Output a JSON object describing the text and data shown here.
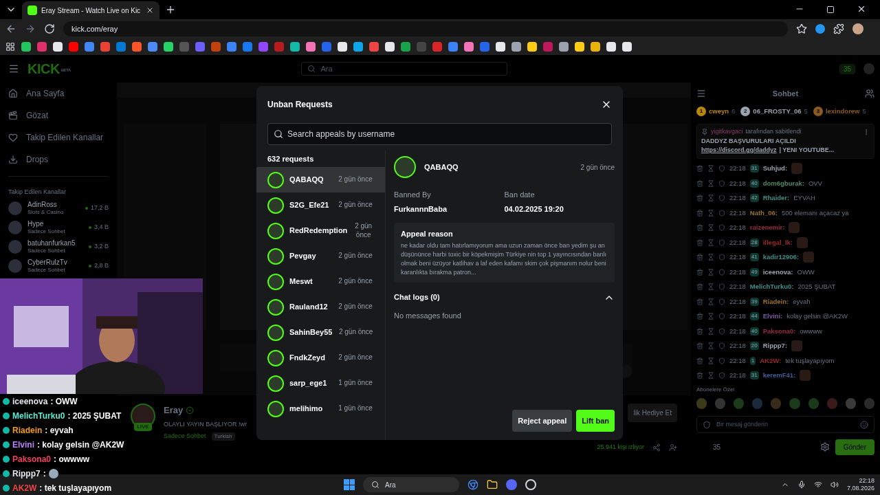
{
  "browser": {
    "tab_title": "Eray Stream - Watch Live on Kic",
    "url": "kick.com/eray"
  },
  "site": {
    "logo": "KICK",
    "logo_tag": "BETA",
    "search_placeholder": "Ara",
    "points": "35"
  },
  "sidebar": {
    "nav": [
      "Ana Sayfa",
      "Gözat",
      "Takip Edilen Kanallar",
      "Drops"
    ],
    "section": "Takip Edilen Kanallar",
    "channels": [
      {
        "name": "AdinRoss",
        "category": "Slots & Casino",
        "viewers": "17,2 B"
      },
      {
        "name": "Hype",
        "category": "Sadece Sohbet",
        "viewers": "3,4 B"
      },
      {
        "name": "batuhanfurkan5",
        "category": "Sadece Sohbet",
        "viewers": "3,2 B"
      },
      {
        "name": "CyberRulzTv",
        "category": "Sadece Sohbet",
        "viewers": "2,8 B"
      }
    ]
  },
  "stream": {
    "streamer": "Eray",
    "live_badge": "LIVE",
    "title": "OLAYLI YAYIN BAŞLIYOR !wr",
    "tags": [
      "Sadece Sohbet",
      "Turkish"
    ],
    "viewers": "25.941 kişi izliyor",
    "gift_button": "lik Hediye Et"
  },
  "modal": {
    "title": "Unban Requests",
    "search_placeholder": "Search appeals by username",
    "count": "632 requests",
    "requests": [
      {
        "name": "QABAQQ",
        "time": "2 gün önce",
        "selected": true
      },
      {
        "name": "S2G_Efe21",
        "time": "2 gün önce",
        "selected": false
      },
      {
        "name": "RedRedemption",
        "time": "2 gün önce",
        "selected": false
      },
      {
        "name": "Pevgay",
        "time": "2 gün önce",
        "selected": false
      },
      {
        "name": "Meswt",
        "time": "2 gün önce",
        "selected": false
      },
      {
        "name": "Rauland12",
        "time": "2 gün önce",
        "selected": false
      },
      {
        "name": "SahinBey55",
        "time": "2 gün önce",
        "selected": false
      },
      {
        "name": "FndkZeyd",
        "time": "2 gün önce",
        "selected": false
      },
      {
        "name": "sarp_ege1",
        "time": "1 gün önce",
        "selected": false
      },
      {
        "name": "melihimo",
        "time": "1 gün önce",
        "selected": false
      }
    ],
    "detail": {
      "name": "QABAQQ",
      "time": "2 gün önce",
      "banned_by_label": "Banned By",
      "banned_by": "FurkannnBaba",
      "ban_date_label": "Ban date",
      "ban_date": "04.02.2025 19:20",
      "appeal_label": "Appeal reason",
      "appeal": "ne kadar oldu tam hatırlamıyorum ama uzun zaman önce ban yedim şu an düşününce harbi toxic bir köpekmişim Türkiye nin top 1 yayıncısından banlı olmak beni üzüyor katlihav a laf eden kafamı skim çok pişmanım nolur beni karanlıkta bırakma patron...",
      "chat_logs_label": "Chat logs (0)",
      "chat_logs_expanded": true,
      "empty": "No messages found"
    },
    "buttons": {
      "reject": "Reject appeal",
      "lift": "Lift ban"
    }
  },
  "chat": {
    "title": "Sohbet",
    "top_gifters": [
      {
        "rank": "1",
        "name": "cweyn",
        "count": "6",
        "color": "#b8860b"
      },
      {
        "rank": "2",
        "name": "06_FROSTY_06",
        "count": "5",
        "color": "#9ca3af"
      },
      {
        "rank": "3",
        "name": "lexindorew",
        "count": "5",
        "color": "#8a5a1f"
      }
    ],
    "pinned": {
      "by": "yigitkavgaci",
      "by_suffix": "tarafından sabitlendi",
      "text": "DADDYZ BAŞVURULARI AÇILDI",
      "link": "https://discord.gg/daddyz",
      "rest": "| YENI YOUTUBE..."
    },
    "messages": [
      {
        "time": "22:18",
        "badge": "31",
        "user": "Suhjud:",
        "color": "#9ca3af",
        "kind": "emote"
      },
      {
        "time": "22:18",
        "badge": "40",
        "user": "dom6gburak:",
        "color": "#4f8a63",
        "kind": "text",
        "text": "OVV"
      },
      {
        "time": "22:18",
        "badge": "42",
        "user": "Rhaider:",
        "color": "#3f8f88",
        "kind": "text",
        "text": "EYVAH"
      },
      {
        "time": "22:18",
        "user": "Nath_06:",
        "color": "#9a7326",
        "kind": "text",
        "text": "500 elemanı açacaz ya"
      },
      {
        "time": "22:18",
        "user": "raizenemir:",
        "color": "#9a2a3f",
        "kind": "emote"
      },
      {
        "time": "22:18",
        "badge": "28",
        "user": "illegal_lk:",
        "color": "#9a2a2a",
        "kind": "emote"
      },
      {
        "time": "22:18",
        "badge": "41",
        "user": "kadir12906:",
        "color": "#3f8f88",
        "kind": "emote"
      },
      {
        "time": "22:18",
        "badge": "49",
        "user": "iceenova:",
        "color": "#9ca3af",
        "kind": "text",
        "text": "OWW"
      },
      {
        "time": "22:18",
        "user": "MelichTurku0:",
        "color": "#3f8f88",
        "kind": "text",
        "text": "2025 ŞUBAT"
      },
      {
        "time": "22:18",
        "badge": "39",
        "user": "Riadein:",
        "color": "#9a7326",
        "kind": "text",
        "text": "eyvah"
      },
      {
        "time": "22:18",
        "badge": "44",
        "user": "Elvini:",
        "color": "#7a55a0",
        "kind": "text",
        "text": "kolay gelsin @AK2W"
      },
      {
        "time": "22:18",
        "badge": "40",
        "user": "Paksona0:",
        "color": "#9a2a3f",
        "kind": "text",
        "text": "owwww"
      },
      {
        "time": "22:18",
        "badge": "20",
        "user": "Rippp7:",
        "color": "#9ca3af",
        "kind": "emote"
      },
      {
        "time": "22:18",
        "badge": "1",
        "user": "AK2W:",
        "color": "#9a2a2a",
        "kind": "text",
        "text": "tek tuşlayapıyom"
      },
      {
        "time": "22:18",
        "badge": "31",
        "user": "keremF41:",
        "color": "#3f5f9a",
        "kind": "emote"
      }
    ],
    "subscriber_label": "Abonelere Özel",
    "input_placeholder": "Bir mesaj gönderin",
    "points": "35",
    "send": "Gönder"
  },
  "overlay_chat": [
    {
      "user": "iceenova",
      "color": "#e5e7eb",
      "kind": "text",
      "text": ": OWW"
    },
    {
      "user": "MelichTurku0",
      "color": "#5eead4",
      "kind": "text",
      "text": ": 2025 ŞUBAT"
    },
    {
      "user": "Riadein",
      "color": "#f59e0b",
      "kind": "text",
      "text": ": eyvah"
    },
    {
      "user": "Elvini",
      "color": "#c084fc",
      "kind": "text",
      "text": ": kolay gelsin @AK2W"
    },
    {
      "user": "Paksona0",
      "color": "#f43f5e",
      "kind": "text",
      "text": ": owwww"
    },
    {
      "user": "Rippp7",
      "color": "#e5e7eb",
      "kind": "emote",
      "text": ":"
    },
    {
      "user": "AK2W",
      "color": "#ef4444",
      "kind": "text",
      "text": ": tek tuşlayapıyom"
    }
  ],
  "taskbar": {
    "search": "Ara",
    "time": "22:18",
    "date": "7.08.2026"
  }
}
